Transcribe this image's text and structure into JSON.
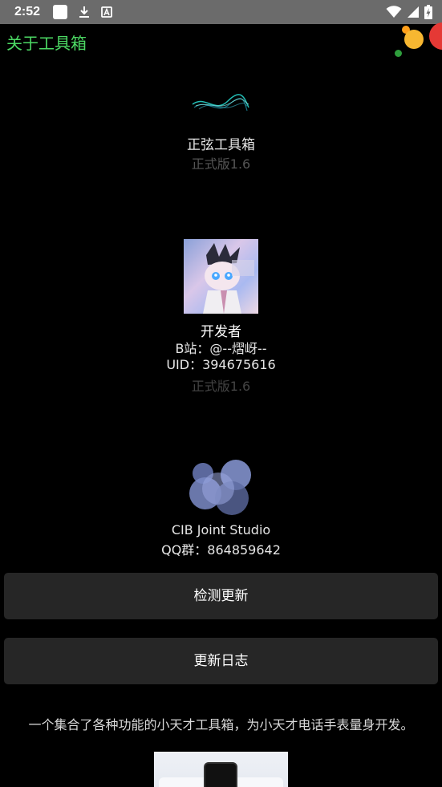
{
  "status_bar": {
    "time": "2:52",
    "left_icons": [
      "notification-square-icon",
      "download-icon",
      "a-box-icon"
    ],
    "right_icons": [
      "wifi-icon",
      "signal-icon",
      "battery-charging-icon"
    ]
  },
  "header": {
    "title": "关于工具箱",
    "title_color": "#4cd964"
  },
  "app_info": {
    "name": "正弦工具箱",
    "version": "正式版1.6"
  },
  "developer": {
    "title": "开发者",
    "bilibili": "B站：@--熠岈--",
    "uid": "UID：394675616",
    "version": "正式版1.6"
  },
  "studio": {
    "name": "CIB Joint Studio",
    "qq_group": "QQ群：864859642"
  },
  "buttons": {
    "check_update": "检测更新",
    "changelog": "更新日志"
  },
  "description": "一个集合了各种功能的小天才工具箱，为小天才电话手表量身开发。",
  "colors": {
    "background": "#000000",
    "button_bg": "#262626",
    "status_bar_bg": "#6b6b6b"
  }
}
